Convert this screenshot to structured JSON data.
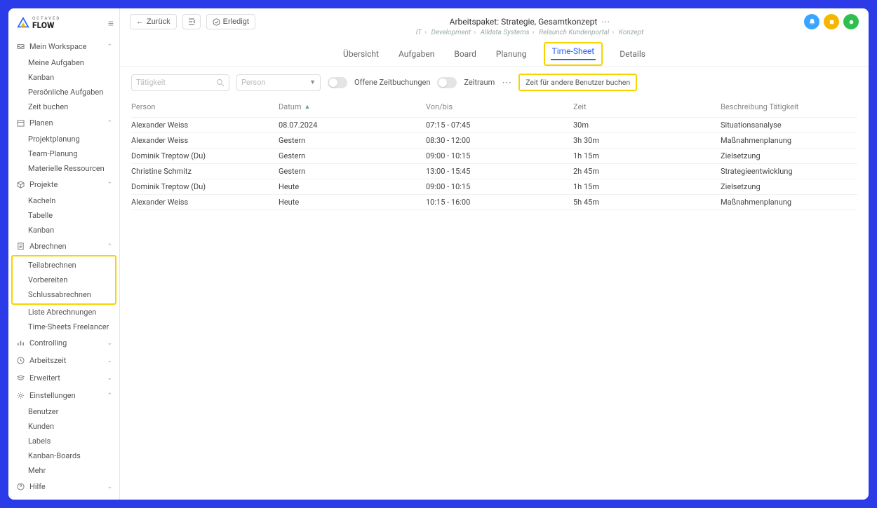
{
  "brand": {
    "top": "OCTAVED",
    "bottom": "FLOW"
  },
  "topButtons": {
    "back": "Zurück",
    "done": "Erledigt"
  },
  "header": {
    "title": "Arbeitspaket: Strategie, Gesamtkonzept",
    "breadcrumb": [
      "IT",
      "Development",
      "Alldata Systems",
      "Relaunch Kundenportal",
      "Konzept"
    ]
  },
  "tabs": [
    "Übersicht",
    "Aufgaben",
    "Board",
    "Planung",
    "Time-Sheet",
    "Details"
  ],
  "activeTab": "Time-Sheet",
  "filters": {
    "activityPh": "Tätigkeit",
    "personPh": "Person",
    "openLabel": "Offene Zeitbuchungen",
    "rangeLabel": "Zeitraum",
    "otherUser": "Zeit für andere Benutzer buchen"
  },
  "columns": {
    "person": "Person",
    "date": "Datum",
    "range": "Von/bis",
    "time": "Zeit",
    "desc": "Beschreibung Tätigkeit"
  },
  "rows": [
    {
      "person": "Alexander Weiss",
      "date": "08.07.2024",
      "range": "07:15 - 07:45",
      "time": "30m",
      "desc": "Situationsanalyse"
    },
    {
      "person": "Alexander Weiss",
      "date": "Gestern",
      "range": "08:30 - 12:00",
      "time": "3h 30m",
      "desc": "Maßnahmenplanung"
    },
    {
      "person": "Dominik Treptow (Du)",
      "date": "Gestern",
      "range": "09:00 - 10:15",
      "time": "1h 15m",
      "desc": "Zielsetzung"
    },
    {
      "person": "Christine Schmitz",
      "date": "Gestern",
      "range": "13:00 - 15:45",
      "time": "2h 45m",
      "desc": "Strategieentwicklung"
    },
    {
      "person": "Dominik Treptow (Du)",
      "date": "Heute",
      "range": "09:00 - 10:15",
      "time": "1h 15m",
      "desc": "Zielsetzung"
    },
    {
      "person": "Alexander Weiss",
      "date": "Heute",
      "range": "10:15 - 16:00",
      "time": "5h 45m",
      "desc": "Maßnahmenplanung"
    }
  ],
  "sidebar": [
    {
      "label": "Mein Workspace",
      "icon": "inbox",
      "open": true,
      "items": [
        "Meine Aufgaben",
        "Kanban",
        "Persönliche Aufgaben",
        "Zeit buchen"
      ]
    },
    {
      "label": "Planen",
      "icon": "calendar",
      "open": true,
      "items": [
        "Projektplanung",
        "Team-Planung",
        "Materielle Ressourcen"
      ]
    },
    {
      "label": "Projekte",
      "icon": "cube",
      "open": true,
      "items": [
        "Kacheln",
        "Tabelle",
        "Kanban"
      ]
    },
    {
      "label": "Abrechnen",
      "icon": "doc",
      "open": true,
      "highlightStart": 0,
      "highlightEnd": 2,
      "items": [
        "Teilabrechnen",
        "Vorbereiten",
        "Schlussabrechnen",
        "Liste Abrechnungen",
        "Time-Sheets Freelancer"
      ]
    },
    {
      "label": "Controlling",
      "icon": "bars",
      "open": false,
      "items": []
    },
    {
      "label": "Arbeitszeit",
      "icon": "clock",
      "open": false,
      "items": []
    },
    {
      "label": "Erweitert",
      "icon": "stack",
      "open": false,
      "items": []
    },
    {
      "label": "Einstellungen",
      "icon": "gear",
      "open": true,
      "items": [
        "Benutzer",
        "Kunden",
        "Labels",
        "Kanban-Boards",
        "Mehr"
      ]
    },
    {
      "label": "Hilfe",
      "icon": "help",
      "open": false,
      "items": []
    }
  ]
}
